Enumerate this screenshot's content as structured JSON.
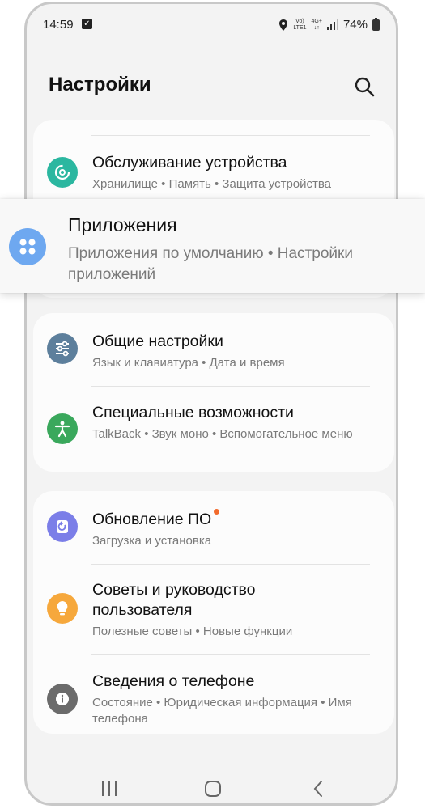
{
  "status_bar": {
    "time": "14:59",
    "network_top": "Vo)",
    "network_bottom": "LTE1",
    "net_gen": "4G+",
    "battery": "74%"
  },
  "header": {
    "title": "Настройки"
  },
  "settings": {
    "device_care": {
      "title": "Обслуживание устройства",
      "subtitle": "Хранилище • Память • Защита устройства",
      "icon_color": "#2bb7a0"
    },
    "apps": {
      "title": "Приложения",
      "subtitle": "Приложения по умолчанию • Настройки приложений",
      "icon_color": "#6ea8f0"
    },
    "general": {
      "title": "Общие настройки",
      "subtitle": "Язык и клавиатура • Дата и время",
      "icon_color": "#5d7f9c"
    },
    "accessibility": {
      "title": "Специальные возможности",
      "subtitle": "TalkBack • Звук моно • Вспомогательное меню",
      "icon_color": "#3aa85c"
    },
    "software_update": {
      "title": "Обновление ПО",
      "subtitle": "Загрузка и установка",
      "icon_color": "#7b7ee8",
      "badge_color": "#f26a2c"
    },
    "tips": {
      "title": "Советы и руководство пользователя",
      "subtitle": "Полезные советы • Новые функции",
      "icon_color": "#f6a83c"
    },
    "about": {
      "title": "Сведения о телефоне",
      "subtitle": "Состояние • Юридическая информация • Имя телефона",
      "icon_color": "#6b6b6b"
    }
  },
  "icons": {
    "search": "search-icon",
    "device_care": "device-care-icon",
    "apps": "apps-grid-icon",
    "general": "sliders-icon",
    "accessibility": "accessibility-person-icon",
    "software_update": "update-icon",
    "tips": "lightbulb-icon",
    "about": "info-icon",
    "nav_recents": "recents-icon",
    "nav_home": "home-icon",
    "nav_back": "back-icon"
  }
}
